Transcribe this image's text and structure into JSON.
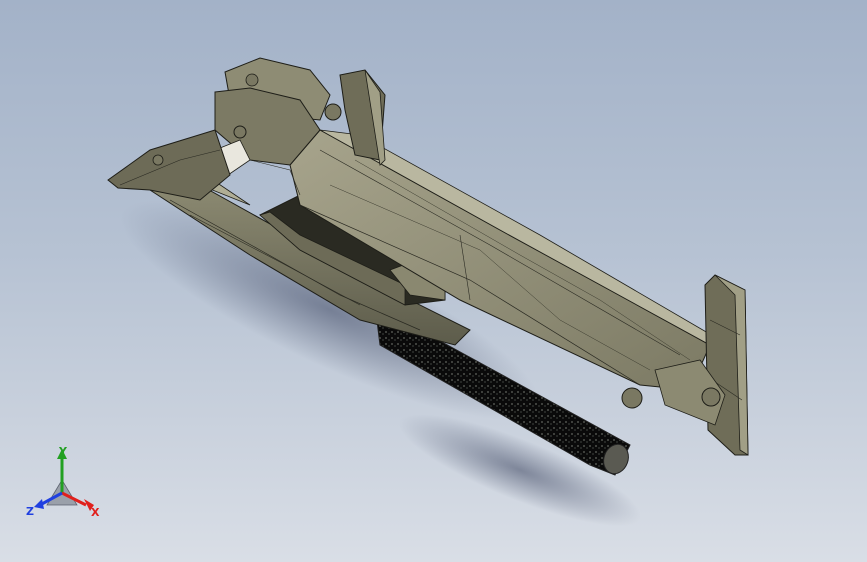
{
  "viewport": {
    "background_top": "#a3b2c8",
    "background_bottom": "#d9dee6",
    "model_color": "#8e8c74",
    "model_edge_color": "#2a2a22"
  },
  "triad": {
    "x_label": "X",
    "y_label": "Y",
    "z_label": "Z",
    "x_color": "#e0201c",
    "y_color": "#22a022",
    "z_color": "#2040e0"
  }
}
